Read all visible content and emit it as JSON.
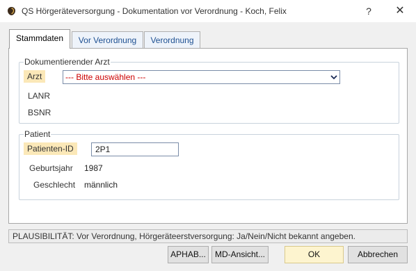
{
  "window": {
    "title": "QS Hörgeräteversorgung - Dokumentation vor Verordnung - Koch, Felix",
    "help_label": "?",
    "close_label": "✕",
    "icon": "hearing-aid-app-icon"
  },
  "tabs": [
    {
      "label": "Stammdaten",
      "active": true
    },
    {
      "label": "Vor Verordnung",
      "active": false
    },
    {
      "label": "Verordnung",
      "active": false
    }
  ],
  "arzt_group": {
    "legend": "Dokumentierender Arzt",
    "arzt_label": "Arzt",
    "arzt_select_value": "--- Bitte auswählen ---",
    "lanr_label": "LANR",
    "bsnr_label": "BSNR"
  },
  "patient_group": {
    "legend": "Patient",
    "patienten_id_label": "Patienten-ID",
    "patienten_id_value": "2P1",
    "geburtsjahr_label": "Geburtsjahr",
    "geburtsjahr_value": "1987",
    "geschlecht_label": "Geschlecht",
    "geschlecht_value": "männlich"
  },
  "status": {
    "text": "PLAUSIBILITÄT: Vor Verordnung, Hörgeräteerstversorgung: Ja/Nein/Nicht bekannt angeben."
  },
  "buttons": {
    "aphab": "APHAB...",
    "md_ansicht": "MD-Ansicht...",
    "ok": "OK",
    "abbrechen": "Abbrechen"
  },
  "colors": {
    "required_field_bg": "#fbe8b8",
    "placeholder_red": "#cc0000",
    "tab_inactive_text": "#1d4f91",
    "ok_button_bg": "#fdf4cf"
  }
}
